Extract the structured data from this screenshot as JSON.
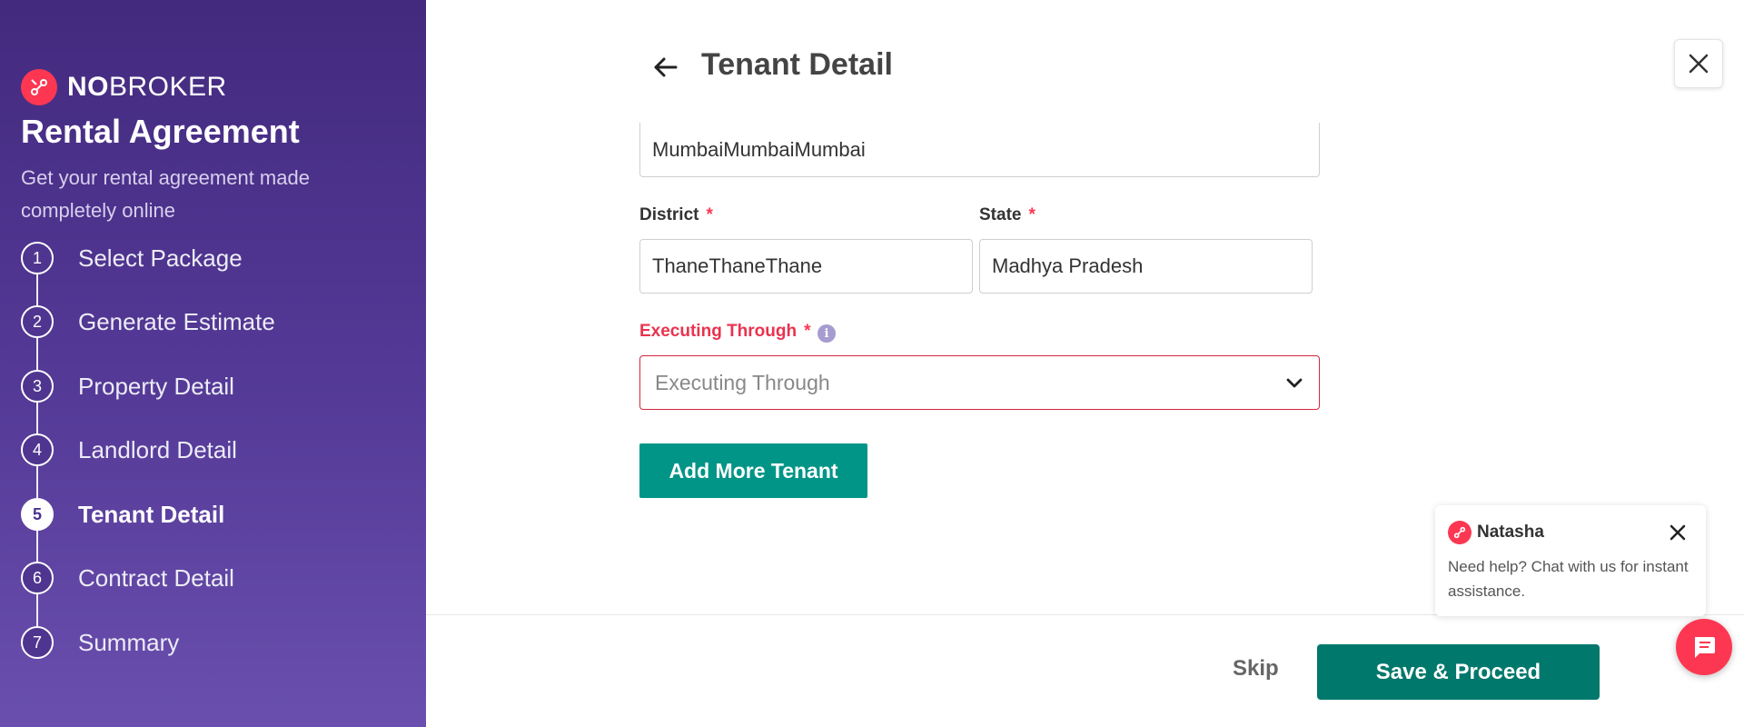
{
  "sidebar": {
    "logo": {
      "no": "NO",
      "broker": "BROKER"
    },
    "title": "Rental Agreement",
    "subtitle": "Get your rental agreement made completely online",
    "steps": [
      {
        "num": "1",
        "label": "Select Package"
      },
      {
        "num": "2",
        "label": "Generate Estimate"
      },
      {
        "num": "3",
        "label": "Property Detail"
      },
      {
        "num": "4",
        "label": "Landlord Detail"
      },
      {
        "num": "5",
        "label": "Tenant Detail"
      },
      {
        "num": "6",
        "label": "Contract Detail"
      },
      {
        "num": "7",
        "label": "Summary"
      }
    ],
    "active_step": 5
  },
  "header": {
    "title": "Tenant Detail"
  },
  "form": {
    "city_value": "MumbaiMumbaiMumbai",
    "district": {
      "label": "District",
      "required": "*",
      "value": "ThaneThaneThane"
    },
    "state": {
      "label": "State",
      "required": "*",
      "value": "Madhya Pradesh"
    },
    "executing_through": {
      "label": "Executing Through",
      "required": "*",
      "placeholder": "Executing Through",
      "info": "i"
    },
    "add_tenant_label": "Add More Tenant"
  },
  "footer": {
    "skip_label": "Skip",
    "save_label": "Save & Proceed"
  },
  "chat": {
    "name": "Natasha",
    "message": "Need help? Chat with us for instant assistance."
  },
  "colors": {
    "brand_red": "#fd3752",
    "sidebar_purple": "#4f3590",
    "teal": "#009587",
    "teal_dark": "#00786b",
    "error_red": "#d7263d"
  }
}
